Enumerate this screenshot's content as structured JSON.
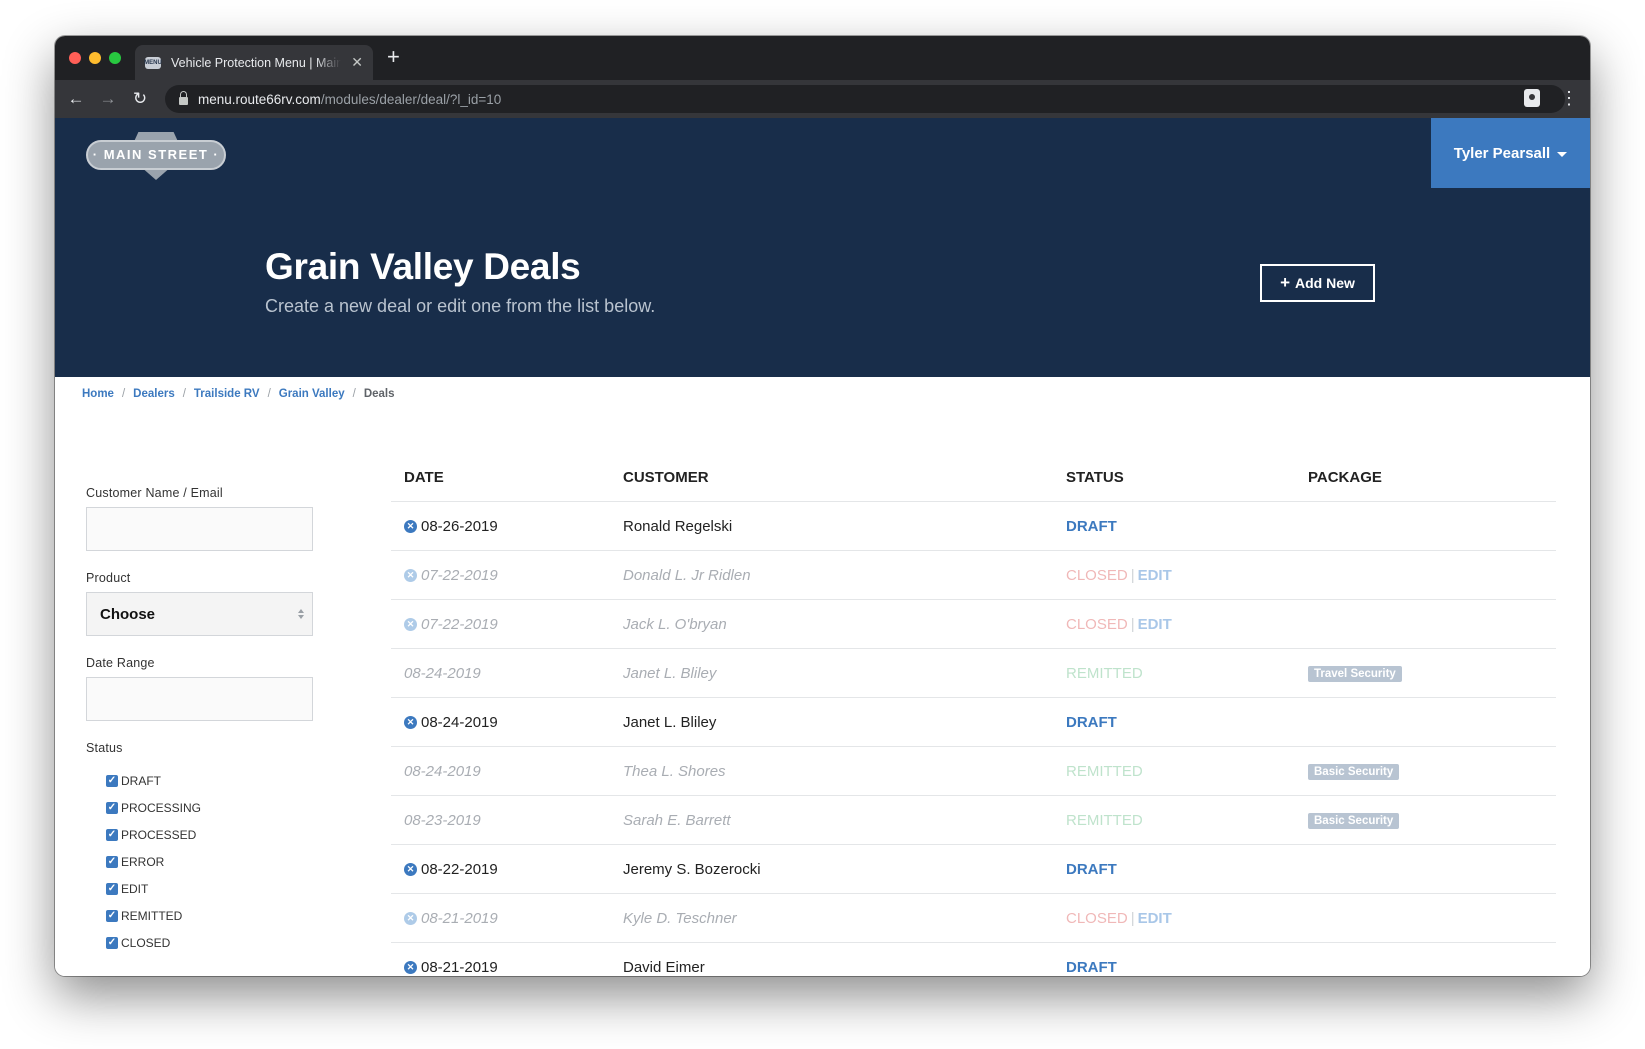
{
  "browser": {
    "tab_title": "Vehicle Protection Menu | Main Street",
    "favicon_text": "MENU",
    "url_host": "menu.route66rv.com",
    "url_path": "/modules/dealer/deal/?l_id=10",
    "traffic_light_colors": [
      "#ff5f57",
      "#febc2e",
      "#28c840"
    ]
  },
  "header": {
    "logo_text": "· MAIN STREET ·",
    "user_name": "Tyler Pearsall",
    "title": "Grain Valley Deals",
    "subtitle": "Create a new deal or edit one from the list below.",
    "add_button": "Add New",
    "background_color": "#182d4a",
    "accent_color": "#3c79bf"
  },
  "breadcrumb": {
    "items": [
      "Home",
      "Dealers",
      "Trailside RV",
      "Grain Valley"
    ],
    "current": "Deals",
    "separator": "/"
  },
  "filters": {
    "name_label": "Customer Name / Email",
    "name_value": "",
    "product_label": "Product",
    "product_value": "Choose",
    "date_label": "Date Range",
    "date_value": "",
    "status_label": "Status",
    "statuses": [
      {
        "label": "DRAFT",
        "checked": true
      },
      {
        "label": "PROCESSING",
        "checked": true
      },
      {
        "label": "PROCESSED",
        "checked": true
      },
      {
        "label": "ERROR",
        "checked": true
      },
      {
        "label": "EDIT",
        "checked": true
      },
      {
        "label": "REMITTED",
        "checked": true
      },
      {
        "label": "CLOSED",
        "checked": true
      }
    ]
  },
  "table": {
    "headers": {
      "date": "DATE",
      "customer": "CUSTOMER",
      "status": "STATUS",
      "package": "PACKAGE"
    },
    "edit_label": "EDIT",
    "rows": [
      {
        "date": "08-26-2019",
        "customer": "Ronald Regelski",
        "status": "DRAFT",
        "package": "",
        "faded": false,
        "deletable": true,
        "editable": false
      },
      {
        "date": "07-22-2019",
        "customer": "Donald L. Jr Ridlen",
        "status": "CLOSED",
        "package": "",
        "faded": true,
        "deletable": true,
        "editable": true
      },
      {
        "date": "07-22-2019",
        "customer": "Jack L. O'bryan",
        "status": "CLOSED",
        "package": "",
        "faded": true,
        "deletable": true,
        "editable": true
      },
      {
        "date": "08-24-2019",
        "customer": "Janet L. Bliley",
        "status": "REMITTED",
        "package": "Travel Security",
        "faded": true,
        "deletable": false,
        "editable": false
      },
      {
        "date": "08-24-2019",
        "customer": "Janet L. Bliley",
        "status": "DRAFT",
        "package": "",
        "faded": false,
        "deletable": true,
        "editable": false
      },
      {
        "date": "08-24-2019",
        "customer": "Thea L. Shores",
        "status": "REMITTED",
        "package": "Basic Security",
        "faded": true,
        "deletable": false,
        "editable": false
      },
      {
        "date": "08-23-2019",
        "customer": "Sarah E. Barrett",
        "status": "REMITTED",
        "package": "Basic Security",
        "faded": true,
        "deletable": false,
        "editable": false
      },
      {
        "date": "08-22-2019",
        "customer": "Jeremy S. Bozerocki",
        "status": "DRAFT",
        "package": "",
        "faded": false,
        "deletable": true,
        "editable": false
      },
      {
        "date": "08-21-2019",
        "customer": "Kyle D. Teschner",
        "status": "CLOSED",
        "package": "",
        "faded": true,
        "deletable": true,
        "editable": true
      },
      {
        "date": "08-21-2019",
        "customer": "David Eimer",
        "status": "DRAFT",
        "package": "",
        "faded": false,
        "deletable": true,
        "editable": false
      }
    ]
  }
}
